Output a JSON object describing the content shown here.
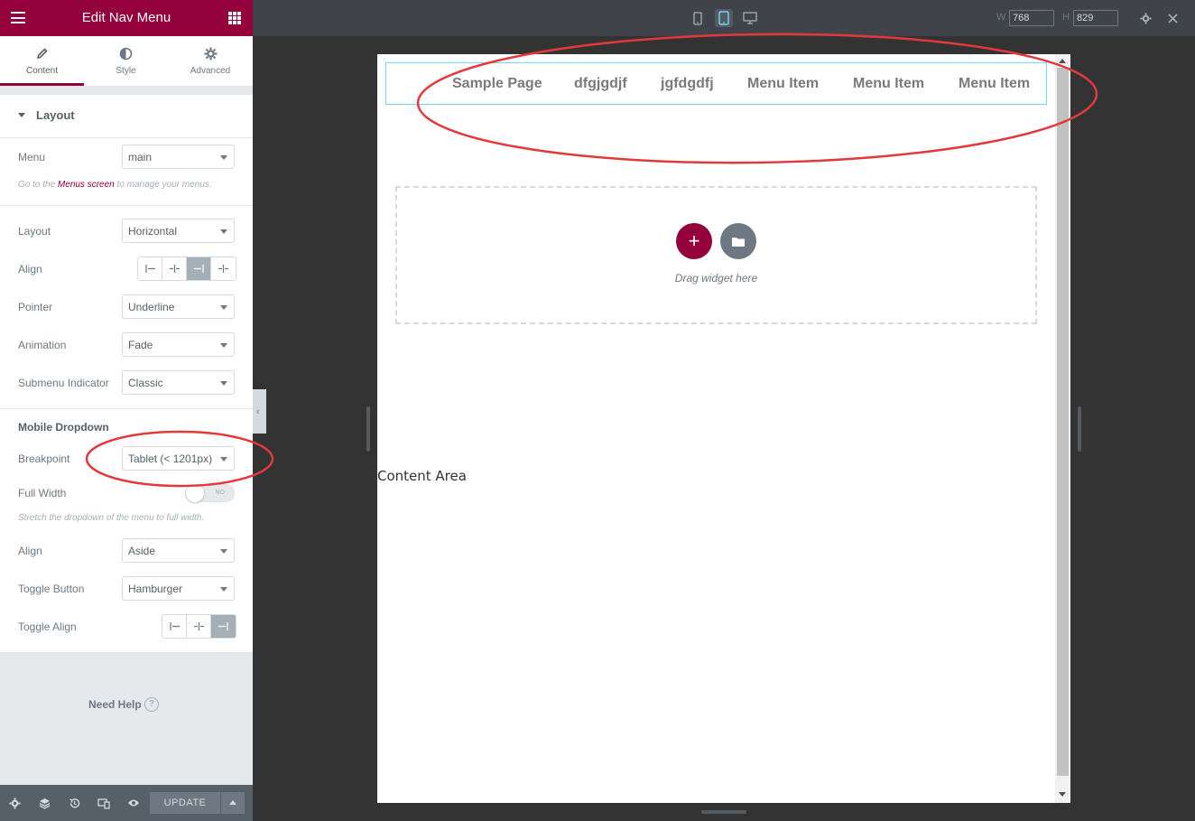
{
  "panel": {
    "title": "Edit Nav Menu",
    "tabs": [
      {
        "label": "Content",
        "icon": "pencil-icon"
      },
      {
        "label": "Style",
        "icon": "half-circle-icon"
      },
      {
        "label": "Advanced",
        "icon": "gear-icon"
      }
    ],
    "section_title": "Layout",
    "menu": {
      "label": "Menu",
      "value": "main",
      "help_prefix": "Go to the ",
      "help_link": "Menus screen",
      "help_suffix": " to manage your menus."
    },
    "layout": {
      "label": "Layout",
      "value": "Horizontal"
    },
    "align": {
      "label": "Align",
      "selected": "right"
    },
    "pointer": {
      "label": "Pointer",
      "value": "Underline"
    },
    "animation": {
      "label": "Animation",
      "value": "Fade"
    },
    "submenu_indicator": {
      "label": "Submenu Indicator",
      "value": "Classic"
    },
    "mobile_dropdown_heading": "Mobile Dropdown",
    "breakpoint": {
      "label": "Breakpoint",
      "value": "Tablet (< 1201px)"
    },
    "full_width": {
      "label": "Full Width",
      "toggle_text": "NO",
      "description": "Stretch the dropdown of the menu to full width."
    },
    "dropdown_align": {
      "label": "Align",
      "value": "Aside"
    },
    "toggle_button": {
      "label": "Toggle Button",
      "value": "Hamburger"
    },
    "toggle_align": {
      "label": "Toggle Align",
      "selected": "right"
    },
    "need_help": "Need Help",
    "help_icon_text": "?",
    "footer": {
      "update_label": "UPDATE"
    }
  },
  "topbar": {
    "devices": [
      "mobile-icon",
      "tablet-icon",
      "desktop-icon"
    ],
    "active_device": "tablet",
    "width_label": "W",
    "width_value": "768",
    "height_label": "H",
    "height_value": "829"
  },
  "canvas": {
    "nav_items": [
      "Sample Page",
      "dfgjgdjf",
      "jgfdgdfj",
      "Menu Item",
      "Menu Item",
      "Menu Item"
    ],
    "add_symbol": "+",
    "drag_text": "Drag widget here",
    "content_area": "Content Area"
  },
  "colors": {
    "brand": "#93003c",
    "annotation": "#e2393d",
    "nav_border": "#71d7f7",
    "active_device": "#71d7f7"
  }
}
